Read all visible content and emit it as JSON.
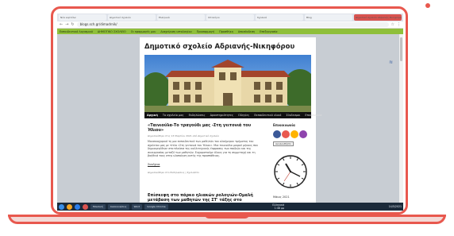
{
  "browser": {
    "tabs": [
      "Νέα καρτέλα",
      "Δημοτικό σχολείο",
      "Ελληνικά",
      "Ιστολόγιο",
      "Σχολικά",
      "Blog",
      "Δημοτικό σχολείο Αδριανής-Νικηφόρου"
    ],
    "url": "blogs.sch.gr/dimadrnik/",
    "bookmarks": [
      "Εκπαιδευτικό λογισμικό",
      "ΔΗΜΟΤΙΚΟ ΣΧΟΛΕΙΟ",
      "Οι εφαρμογές μου",
      "Διαχείριση ιστολογίου",
      "Προσαρμογή",
      "Προσθήκη",
      "Αποσύνδεση",
      "Επεξεργασία"
    ]
  },
  "site": {
    "title": "Δημοτικό σχολείο Αδριανής-Νικηφόρου",
    "menu": [
      "Αρχική",
      "Το σχολείο μας",
      "Εκδηλώσεις",
      "Δραστηριότητες",
      "Οδηγίες",
      "Εκπαιδευτικό υλικό",
      "Σύνδεσμοι",
      "Επικοινωνία"
    ]
  },
  "post": {
    "title": "«Ταινιούλα-Το τραγούδι μας -Στη γειτονιά του Ήλιου»",
    "meta": "Δημοσιεύθηκε στις 13 Μαρτίου 2021 από Δημοτικό σχολείο",
    "body": "Μουσικοχορικό τη μια εκπαιδευτικό των μαθητών του ολοήμερου τμήματος του σχολείου μας με τίτλο «Στη γειτονιά του Ήλιου». Μια ταινιούλα μικρού μήκους που δημιουργήθηκε στα πλαίσια της καλλιτεχνικής έκφρασης των παιδιών και της συνεργασίας μεταξύ των μαθητών. Ευχαριστούμε όλους για τη συμμετοχή και τη βοήθειά τους στην υλοποίηση αυτής της προσπάθειας.",
    "more": "Συνέχεια",
    "foot": "Δημοσιεύθηκε στο Εκδηλώσεις | Σχολιάστε",
    "next_title": "Επίσκεψη στο πάρκο ηλιακών ρολογιών-Ομαλή μετάβαση των μαθητών της ΣΤ' τάξης στο Γυμνάσιο"
  },
  "sidebar": {
    "title": "Επικοινωνία",
    "follow": "Ακολουθήστε",
    "date": "Μάιος 2021",
    "social_colors": [
      "#3b5998",
      "#e95950",
      "#ffb400",
      "#8e44ad",
      "#27ae60"
    ]
  },
  "taskbar": {
    "items": [
      "Μουσική",
      "Ανακοινώσεις",
      "Word",
      "Google Chrome"
    ],
    "time": "1:48 μμ",
    "date": "14/5/2021",
    "tray": "Ελληνικά",
    "icon_colors": [
      "#f5a623",
      "#2b7de9",
      "#d9534f",
      "#27ae60"
    ]
  }
}
